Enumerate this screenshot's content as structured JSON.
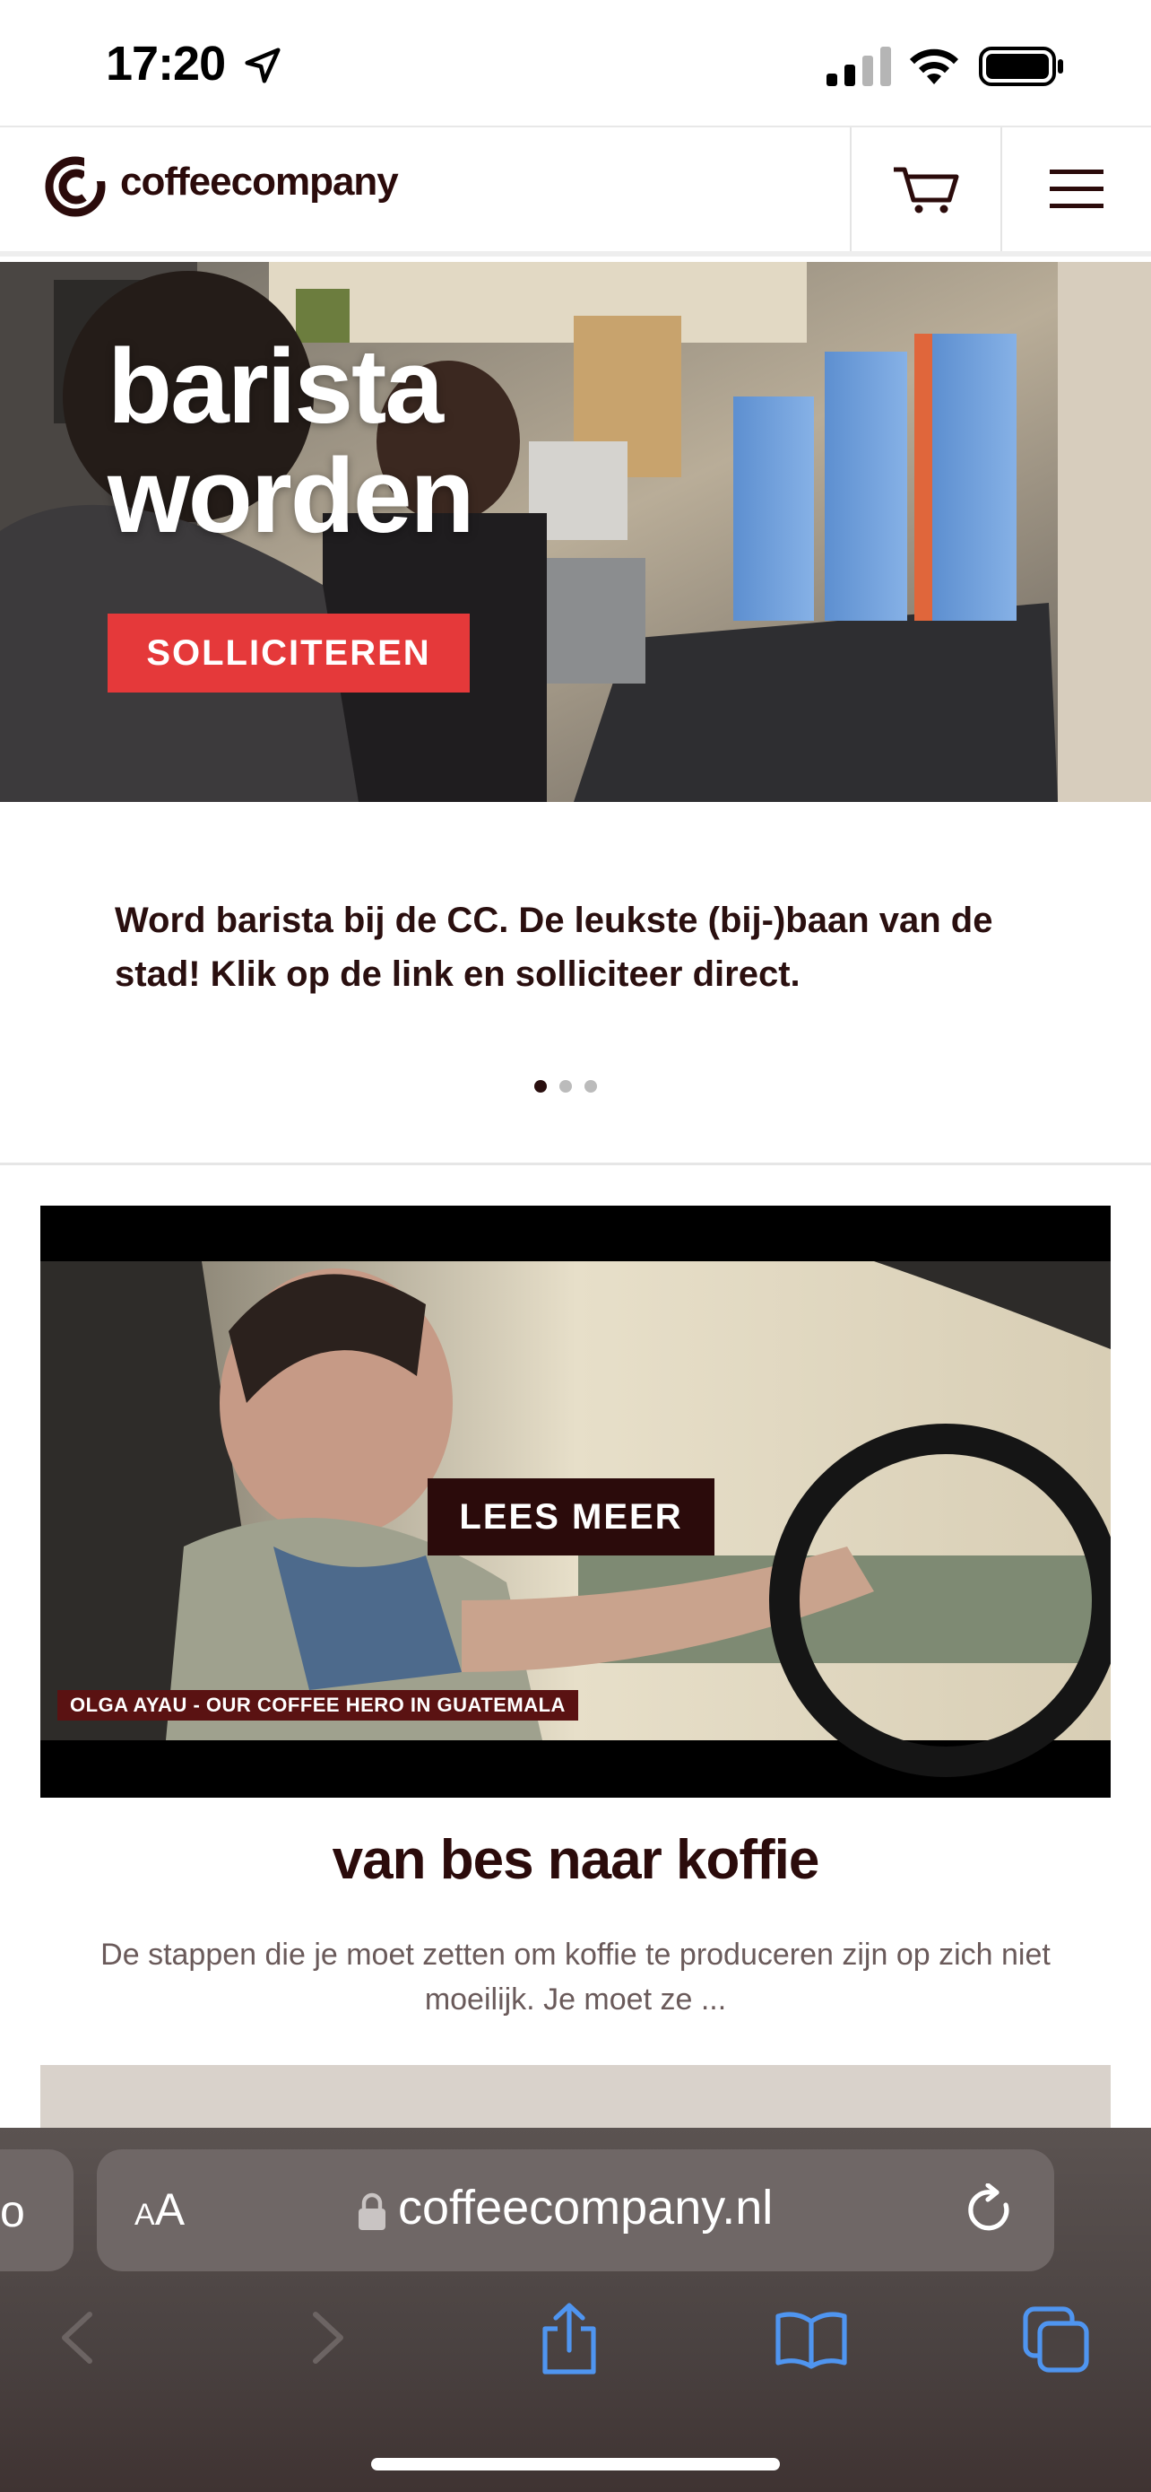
{
  "status_bar": {
    "time": "17:20"
  },
  "header": {
    "logo_text": "coffeecompany",
    "brand_color": "#2b0b0b"
  },
  "hero": {
    "title_line1": "barista",
    "title_line2": "worden",
    "button_label": "SOLLICITEREN",
    "description": "Word barista bij de CC. De leukste (bij-)baan van de stad! Klik op de link en solliciteer direct.",
    "slide_count": 3,
    "active_slide": 1,
    "accent_color": "#e5393a"
  },
  "article": {
    "button_label": "LEES MEER",
    "caption": "OLGA AYAU - OUR COFFEE HERO IN GUATEMALA",
    "title": "van bes naar koffie",
    "excerpt": "De stappen die je moet zetten om koffie te produceren zijn op zich niet moeilijk. Je moet ze ..."
  },
  "browser": {
    "tab_peek_text": "o",
    "text_size_label_small": "A",
    "text_size_label_large": "A",
    "url": "coffeecompany.nl"
  }
}
